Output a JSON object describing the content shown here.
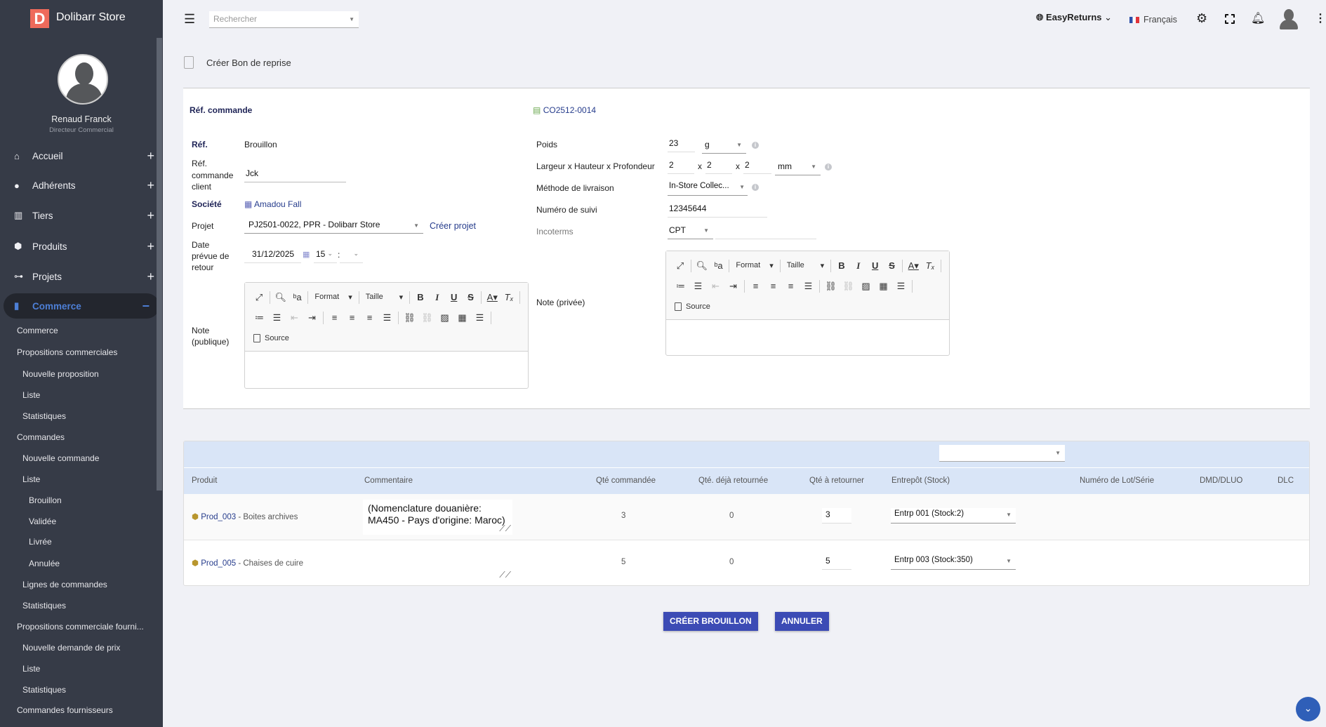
{
  "sidebar": {
    "brand": "Dolibarr Store",
    "logo_letter": "D",
    "user_name": "Renaud Franck",
    "user_role": "Directeur Commercial",
    "menu": [
      {
        "label": "Accueil",
        "icon": "home-icon",
        "toggle": "+"
      },
      {
        "label": "Adhérents",
        "icon": "user-icon",
        "toggle": "+"
      },
      {
        "label": "Tiers",
        "icon": "building-icon",
        "toggle": "+"
      },
      {
        "label": "Produits",
        "icon": "box-icon",
        "toggle": "+"
      },
      {
        "label": "Projets",
        "icon": "project-icon",
        "toggle": "+"
      },
      {
        "label": "Commerce",
        "icon": "briefcase-icon",
        "toggle": "−",
        "active": true
      }
    ],
    "submenu": [
      {
        "label": "Commerce",
        "level": 0
      },
      {
        "label": "Propositions commerciales",
        "level": 0
      },
      {
        "label": "Nouvelle proposition",
        "level": 1
      },
      {
        "label": "Liste",
        "level": 1
      },
      {
        "label": "Statistiques",
        "level": 1
      },
      {
        "label": "Commandes",
        "level": 0
      },
      {
        "label": "Nouvelle commande",
        "level": 1
      },
      {
        "label": "Liste",
        "level": 1
      },
      {
        "label": "Brouillon",
        "level": 2
      },
      {
        "label": "Validée",
        "level": 2
      },
      {
        "label": "Livrée",
        "level": 2
      },
      {
        "label": "Annulée",
        "level": 2
      },
      {
        "label": "Lignes de commandes",
        "level": 1
      },
      {
        "label": "Statistiques",
        "level": 1
      },
      {
        "label": "Propositions commerciale fourni...",
        "level": 0
      },
      {
        "label": "Nouvelle demande de prix",
        "level": 1
      },
      {
        "label": "Liste",
        "level": 1
      },
      {
        "label": "Statistiques",
        "level": 1
      },
      {
        "label": "Commandes fournisseurs",
        "level": 0
      }
    ]
  },
  "topbar": {
    "search_placeholder": "Rechercher",
    "entity": "EasyReturns",
    "language": "Français"
  },
  "page": {
    "title": "Créer Bon de reprise"
  },
  "form": {
    "ref_commande_label": "Réf. commande",
    "ref_commande_value": "CO2512-0014",
    "ref_label": "Réf.",
    "ref_value": "Brouillon",
    "ref_client_label": [
      "Réf.",
      "commande",
      "client"
    ],
    "ref_client_value": "Jck",
    "societe_label": "Société",
    "societe_value": "Amadou Fall",
    "projet_label": "Projet",
    "projet_value": "PJ2501-0022, PPR - Dolibarr Store",
    "creer_projet": "Créer projet",
    "date_label": [
      "Date",
      "prévue de",
      "retour"
    ],
    "date_value": "31/12/2025",
    "hour_value": "15",
    "minute_value": "",
    "note_publique_label": [
      "Note",
      "(publique)"
    ],
    "note_privee_label": "Note (privée)",
    "poids_label": "Poids",
    "poids_value": "23",
    "poids_unit": "g",
    "dims_label": "Largeur x Hauteur x Profondeur",
    "dims": [
      "2",
      "2",
      "2"
    ],
    "dims_sep": "x",
    "dims_unit": "mm",
    "methode_label": "Méthode de livraison",
    "methode_value": "In-Store Collec...",
    "suivi_label": "Numéro de suivi",
    "suivi_value": "12345644",
    "incoterms_label": "Incoterms",
    "incoterms_value": "CPT",
    "incoterms_location": ""
  },
  "editor": {
    "format": "Format",
    "size": "Taille",
    "source": "Source"
  },
  "table": {
    "filter_value": "",
    "headers": [
      "Produit",
      "Commentaire",
      "Qté commandée",
      "Qté. déjà retournée",
      "Qté à retourner",
      "Entrepôt (Stock)",
      "Numéro de Lot/Série",
      "DMD/DLUO",
      "DLC"
    ],
    "rows": [
      {
        "ref": "Prod_003",
        "label": " - Boites archives",
        "comment": "(Nomenclature douanière: MA450 - Pays d'origine: Maroc)",
        "ordered": "3",
        "returned": "0",
        "to_return": "3",
        "warehouse": "Entrp 001 (Stock:2)"
      },
      {
        "ref": "Prod_005",
        "label": " - Chaises de cuire",
        "comment": "",
        "ordered": "5",
        "returned": "0",
        "to_return": "5",
        "warehouse": "Entrp 003 (Stock:350)"
      }
    ]
  },
  "actions": {
    "create": "CRÉER BROUILLON",
    "cancel": "ANNULER"
  },
  "colors": {
    "sidebar": "#363b47",
    "accent": "#4d7fd6",
    "button": "#3c4bb5",
    "table_header": "#d9e5f7",
    "logo": "#ee6a5b"
  }
}
